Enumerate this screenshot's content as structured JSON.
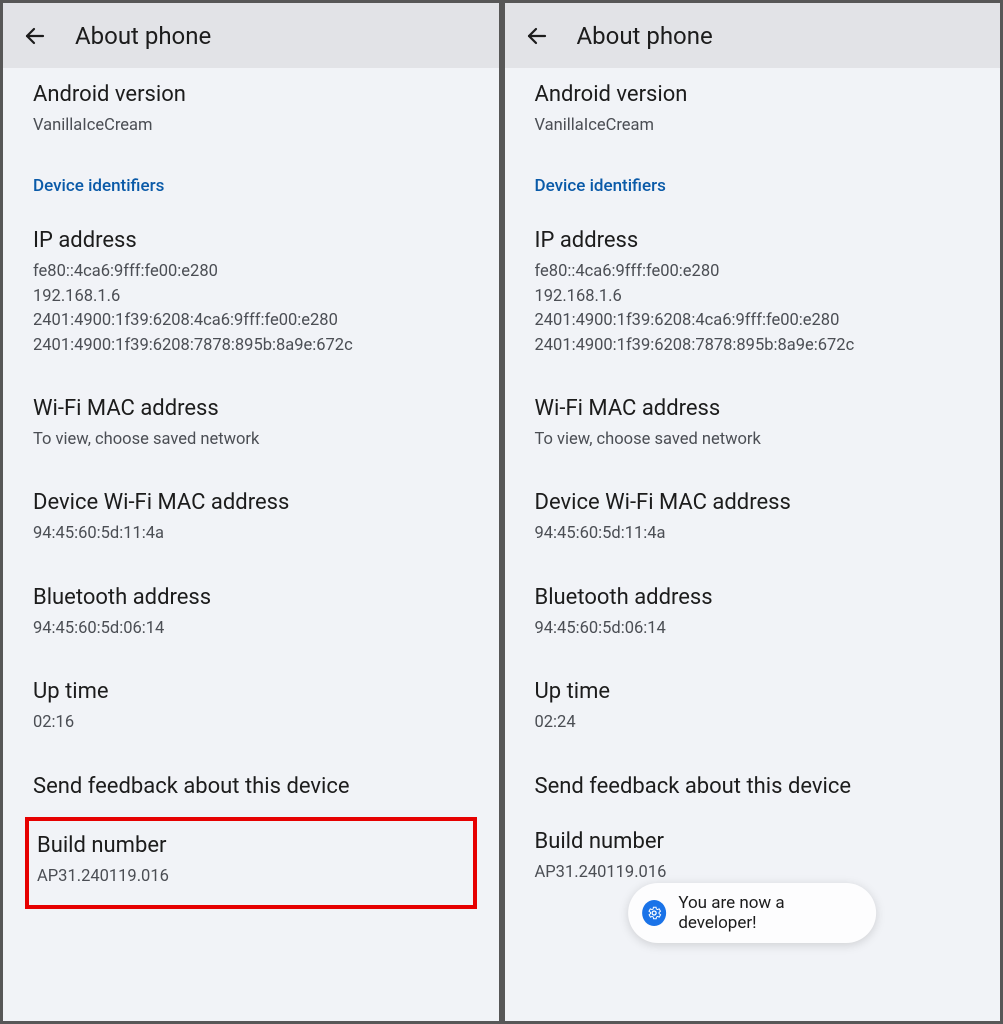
{
  "left": {
    "header": {
      "title": "About phone"
    },
    "android_version": {
      "label": "Android version",
      "value": "VanillaIceCream"
    },
    "section_header": "Device identifiers",
    "ip_address": {
      "label": "IP address",
      "value": "fe80::4ca6:9fff:fe00:e280\n192.168.1.6\n2401:4900:1f39:6208:4ca6:9fff:fe00:e280\n2401:4900:1f39:6208:7878:895b:8a9e:672c"
    },
    "wifi_mac": {
      "label": "Wi-Fi MAC address",
      "value": "To view, choose saved network"
    },
    "device_wifi_mac": {
      "label": "Device Wi-Fi MAC address",
      "value": "94:45:60:5d:11:4a"
    },
    "bluetooth": {
      "label": "Bluetooth address",
      "value": "94:45:60:5d:06:14"
    },
    "uptime": {
      "label": "Up time",
      "value": "02:16"
    },
    "feedback": {
      "label": "Send feedback about this device"
    },
    "build": {
      "label": "Build number",
      "value": "AP31.240119.016"
    }
  },
  "right": {
    "header": {
      "title": "About phone"
    },
    "android_version": {
      "label": "Android version",
      "value": "VanillaIceCream"
    },
    "section_header": "Device identifiers",
    "ip_address": {
      "label": "IP address",
      "value": "fe80::4ca6:9fff:fe00:e280\n192.168.1.6\n2401:4900:1f39:6208:4ca6:9fff:fe00:e280\n2401:4900:1f39:6208:7878:895b:8a9e:672c"
    },
    "wifi_mac": {
      "label": "Wi-Fi MAC address",
      "value": "To view, choose saved network"
    },
    "device_wifi_mac": {
      "label": "Device Wi-Fi MAC address",
      "value": "94:45:60:5d:11:4a"
    },
    "bluetooth": {
      "label": "Bluetooth address",
      "value": "94:45:60:5d:06:14"
    },
    "uptime": {
      "label": "Up time",
      "value": "02:24"
    },
    "feedback": {
      "label": "Send feedback about this device"
    },
    "build": {
      "label": "Build number",
      "value": "AP31.240119.016"
    },
    "toast": {
      "text": "You are now a developer!"
    }
  }
}
